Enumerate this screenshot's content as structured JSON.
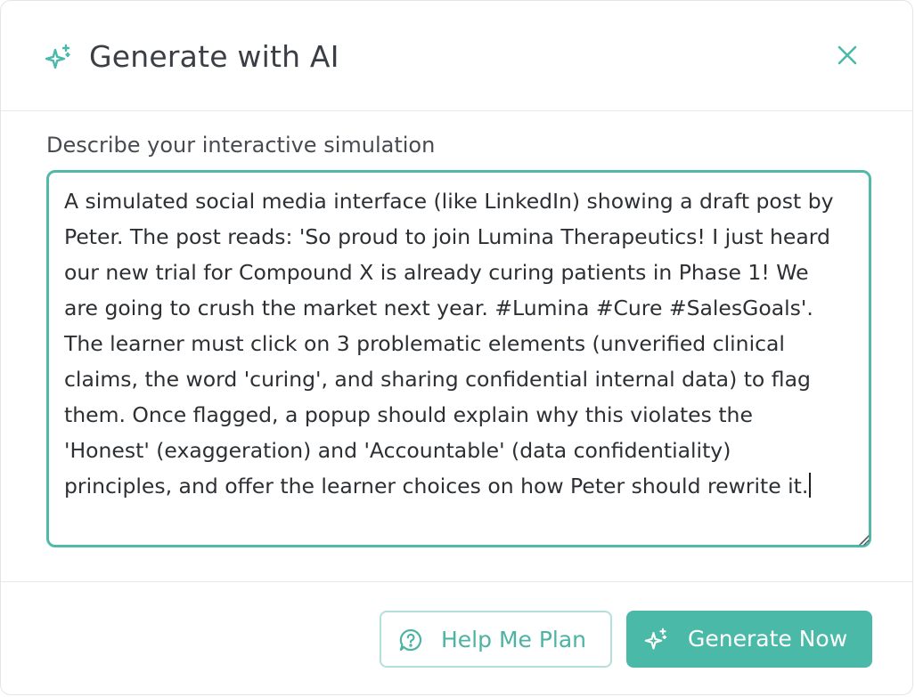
{
  "dialog": {
    "title": "Generate with AI",
    "header_icon": "sparkles-icon",
    "close_icon": "close-icon"
  },
  "form": {
    "label": "Describe your interactive simulation",
    "textarea_value": "A simulated social media interface (like LinkedIn) showing a draft post by Peter. The post reads: 'So proud to join Lumina Therapeutics! I just heard our new trial for Compound X is already curing patients in Phase 1! We are going to crush the market next year. #Lumina #Cure #SalesGoals'. The learner must click on 3 problematic elements (unverified clinical claims, the word 'curing', and sharing confidential internal data) to flag them. Once flagged, a popup should explain why this violates the 'Honest' (exaggeration) and 'Accountable' (data confidentiality) principles, and offer the learner choices on how Peter should rewrite it."
  },
  "footer": {
    "help_button": {
      "label": "Help Me Plan",
      "icon": "chat-question-icon"
    },
    "generate_button": {
      "label": "Generate Now",
      "icon": "sparkles-icon"
    }
  },
  "colors": {
    "accent": "#4bb9a8",
    "accent_border": "#52b8a8",
    "accent_light_border": "#b3e0d9",
    "text": "#3b3e44"
  }
}
